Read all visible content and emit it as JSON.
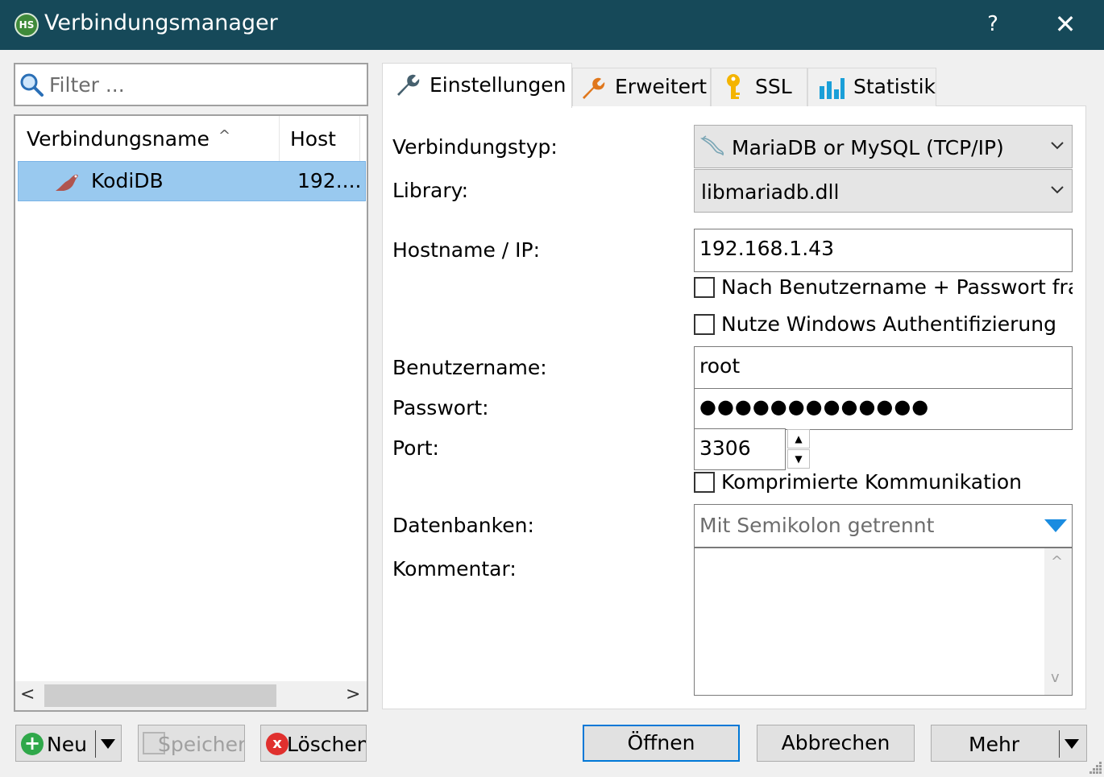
{
  "window": {
    "title": "Verbindungsmanager",
    "app_icon_text": "HS",
    "help_glyph": "?",
    "close_glyph": "✕"
  },
  "filter": {
    "placeholder": "Filter ..."
  },
  "connection_list": {
    "columns": [
      "Verbindungsname",
      "Host"
    ],
    "sort_glyph": "^",
    "rows": [
      {
        "name": "KodiDB",
        "host": "192....",
        "selected": true
      }
    ],
    "scroll_left_glyph": "<",
    "scroll_right_glyph": ">"
  },
  "tabs": [
    {
      "label": "Einstellungen",
      "icon": "wrench-icon",
      "active": true
    },
    {
      "label": "Erweitert",
      "icon": "wrench-icon-orange",
      "active": false
    },
    {
      "label": "SSL",
      "icon": "key-icon",
      "active": false
    },
    {
      "label": "Statistik",
      "icon": "bar-chart-icon",
      "active": false
    }
  ],
  "settings": {
    "labels": {
      "connection_type": "Verbindungstyp:",
      "library": "Library:",
      "hostname": "Hostname / IP:",
      "username": "Benutzername:",
      "password": "Passwort:",
      "port": "Port:",
      "databases": "Datenbanken:",
      "comment": "Kommentar:"
    },
    "connection_type_value": "MariaDB or MySQL (TCP/IP)",
    "library_value": "libmariadb.dll",
    "hostname_value": "192.168.1.43",
    "ask_credentials_label": "Nach Benutzername + Passwort fragen",
    "ask_credentials_checked": false,
    "windows_auth_label": "Nutze Windows Authentifizierung",
    "windows_auth_checked": false,
    "username_value": "root",
    "password_masked": "●●●●●●●●●●●●●",
    "port_value": "3306",
    "spin_up_glyph": "▲",
    "spin_down_glyph": "▼",
    "compressed_label": "Komprimierte Kommunikation",
    "compressed_checked": false,
    "databases_placeholder": "Mit Semikolon getrennt",
    "comment_value": "",
    "comment_scroll_up_glyph": "^",
    "comment_scroll_down_glyph": "v"
  },
  "buttons": {
    "new": "Neu",
    "new_icon_glyph": "+",
    "save": "Speichern",
    "delete": "Löschen",
    "delete_icon_glyph": "x",
    "open": "Öffnen",
    "cancel": "Abbrechen",
    "more": "Mehr"
  },
  "colors": {
    "titlebar": "#164959",
    "selection": "#99c9ef",
    "accent": "#0078d7"
  }
}
